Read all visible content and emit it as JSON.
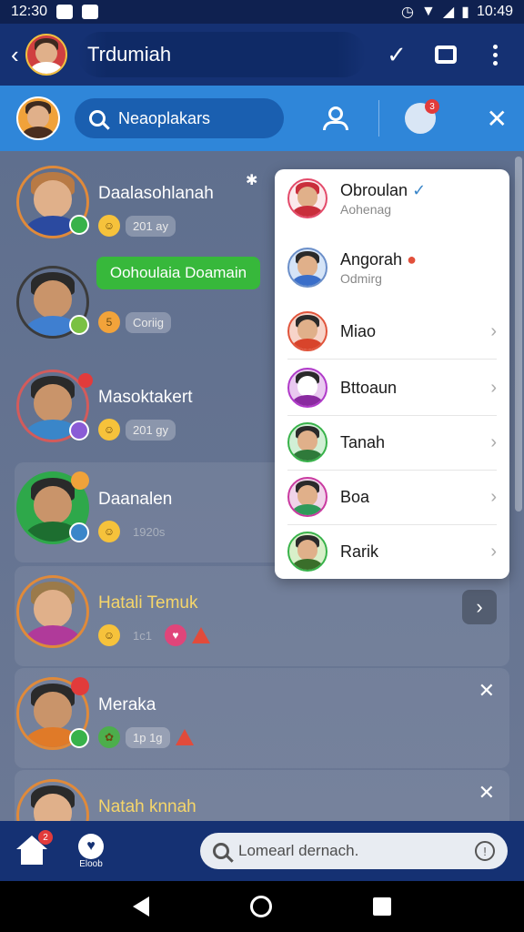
{
  "status_bar": {
    "time": "12:30",
    "battery_time": "10:49"
  },
  "app_bar": {
    "title": "Trdumiah"
  },
  "search": {
    "text": "Neaoplakars",
    "notifications_badge": "3"
  },
  "chats": [
    {
      "name": "Daalasohlanah",
      "meta": "201 ay",
      "accent": "#e08a3a"
    },
    {
      "name": "",
      "pill": "Oohoulaia Doamain",
      "meta": "Coriig",
      "accent": "#3b3b3b"
    },
    {
      "name": "Masoktakert",
      "meta": "201 gy",
      "accent": "#d35b5b"
    },
    {
      "name": "Daanalen",
      "meta": "1920s",
      "accent": "#2ea84a"
    },
    {
      "name": "Hatali Temuk",
      "meta": "1c1",
      "accent": "#e08a3a"
    },
    {
      "name": "Meraka",
      "meta": "1p 1g",
      "accent": "#e08a3a"
    },
    {
      "name": "Natah knnah",
      "meta": "",
      "accent": "#e08a3a"
    }
  ],
  "dropdown": {
    "items": [
      {
        "name": "Obroulan",
        "sub": "Aohenag"
      },
      {
        "name": "Angorah",
        "sub": "Odmirg"
      },
      {
        "name": "Miao",
        "sub": ""
      },
      {
        "name": "Bttoaun",
        "sub": ""
      },
      {
        "name": "Tanah",
        "sub": ""
      },
      {
        "name": "Boa",
        "sub": ""
      },
      {
        "name": "Rarik",
        "sub": ""
      }
    ]
  },
  "bottom_nav": {
    "home_badge": "2",
    "label": "Eloob",
    "search_placeholder": "Lomearl dernach."
  }
}
